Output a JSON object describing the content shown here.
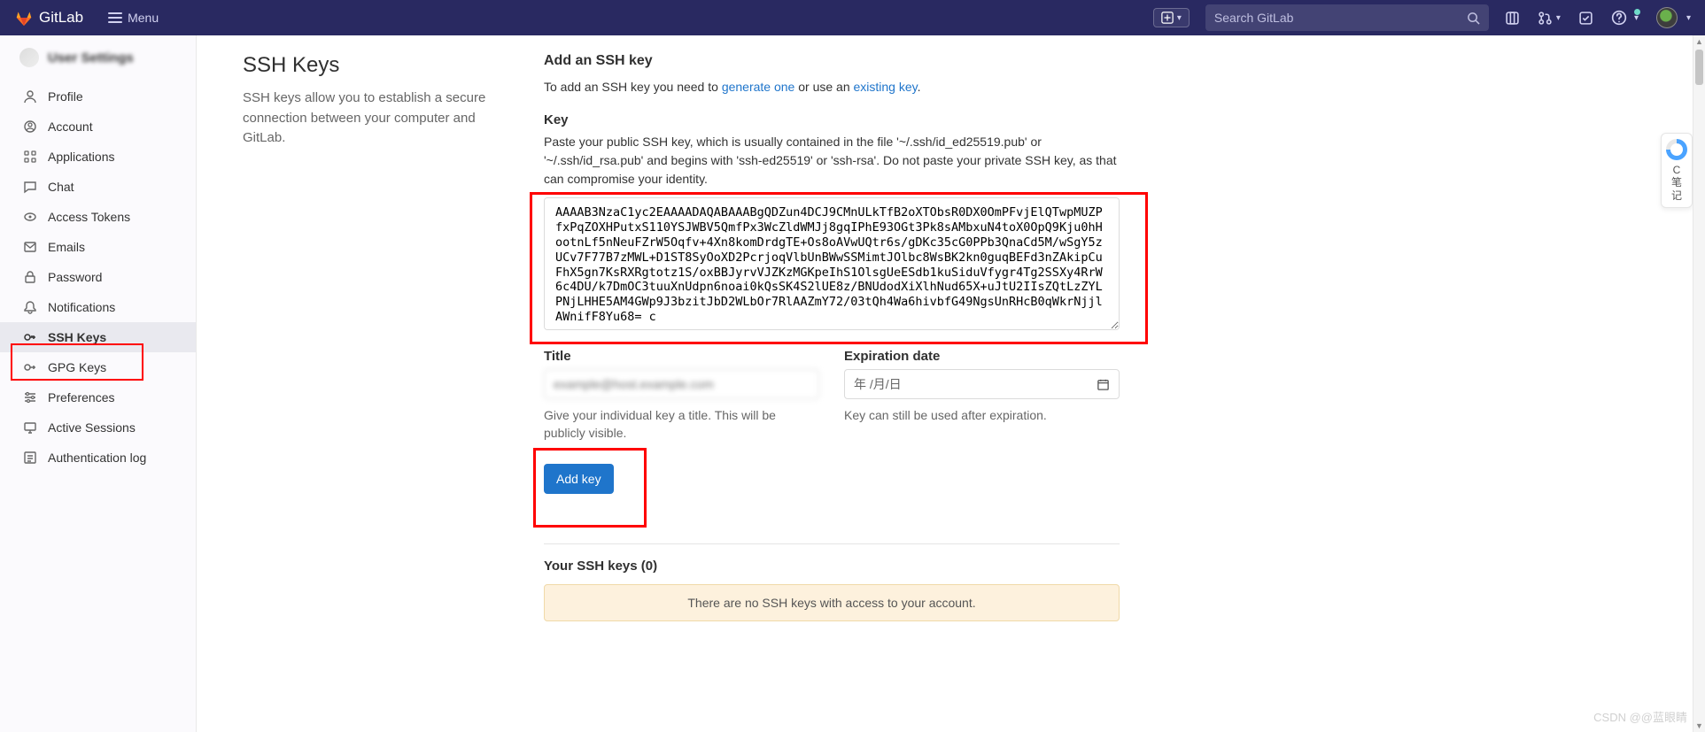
{
  "topnav": {
    "brand": "GitLab",
    "menu_label": "Menu",
    "search_placeholder": "Search GitLab"
  },
  "sidebar": {
    "title": "User Settings",
    "items": [
      {
        "label": "Profile",
        "icon": "profile-icon"
      },
      {
        "label": "Account",
        "icon": "account-icon"
      },
      {
        "label": "Applications",
        "icon": "applications-icon"
      },
      {
        "label": "Chat",
        "icon": "chat-icon"
      },
      {
        "label": "Access Tokens",
        "icon": "access-tokens-icon"
      },
      {
        "label": "Emails",
        "icon": "emails-icon"
      },
      {
        "label": "Password",
        "icon": "password-icon"
      },
      {
        "label": "Notifications",
        "icon": "notifications-icon"
      },
      {
        "label": "SSH Keys",
        "icon": "ssh-keys-icon"
      },
      {
        "label": "GPG Keys",
        "icon": "gpg-keys-icon"
      },
      {
        "label": "Preferences",
        "icon": "preferences-icon"
      },
      {
        "label": "Active Sessions",
        "icon": "active-sessions-icon"
      },
      {
        "label": "Authentication log",
        "icon": "auth-log-icon"
      }
    ],
    "active_index": 8
  },
  "main": {
    "heading": "SSH Keys",
    "description": "SSH keys allow you to establish a secure connection between your computer and GitLab.",
    "add_heading": "Add an SSH key",
    "add_text_prefix": "To add an SSH key you need to ",
    "add_link1": "generate one",
    "add_text_mid": " or use an ",
    "add_link2": "existing key",
    "add_text_suffix": ".",
    "key_label": "Key",
    "key_help": "Paste your public SSH key, which is usually contained in the file '~/.ssh/id_ed25519.pub' or '~/.ssh/id_rsa.pub' and begins with 'ssh-ed25519' or 'ssh-rsa'. Do not paste your private SSH key, as that can compromise your identity.",
    "key_value": "AAAAB3NzaC1yc2EAAAADAQABAAABgQDZun4DCJ9CMnULkTfB2oXTObsR0DX0OmPFvjElQTwpMUZPfxPqZOXHPutxS110YSJWBV5QmfPx3WcZldWMJj8gqIPhE93OGt3Pk8sAMbxuN4toX0OpQ9Kju0hHootnLf5nNeuFZrW5Oqfv+4Xn8komDrdgTE+Os8oAVwUQtr6s/gDKc35cG0PPb3QnaCd5M/wSgY5zUCv7F77B7zMWL+D1ST8SyOoXD2PcrjoqVlbUnBWwSSMimtJOlbc8WsBK2kn0guqBEFd3nZAkipCuFhX5gn7KsRXRgtotz1S/oxBBJyrvVJZKzMGKpeIhS1OlsgUeESdb1kuSiduVfygr4Tg2SSXy4RrW6c4DU/k7DmOC3tuuXnUdpn6noai0kQsSK4S2lUE8z/BNUdodXiXlhNud65X+uJtU2IIsZQtLzZYLPNjLHHE5AM4GWp9J3bzitJbD2WLbOr7RlAAZmY72/03tQh4Wa6hivbfG49NgsUnRHcB0qWkrNjjlAWnifF8Yu68= c",
    "title_label": "Title",
    "title_value": "",
    "title_help": "Give your individual key a title. This will be publicly visible.",
    "expire_label": "Expiration date",
    "expire_placeholder": "年 /月/日",
    "expire_help": "Key can still be used after expiration.",
    "add_btn": "Add key",
    "your_keys_heading": "Your SSH keys (0)",
    "empty_msg": "There are no SSH keys with access to your account."
  },
  "float": {
    "line1": "C",
    "line2": "笔",
    "line3": "记"
  },
  "watermark": "CSDN @@蓝眼睛"
}
